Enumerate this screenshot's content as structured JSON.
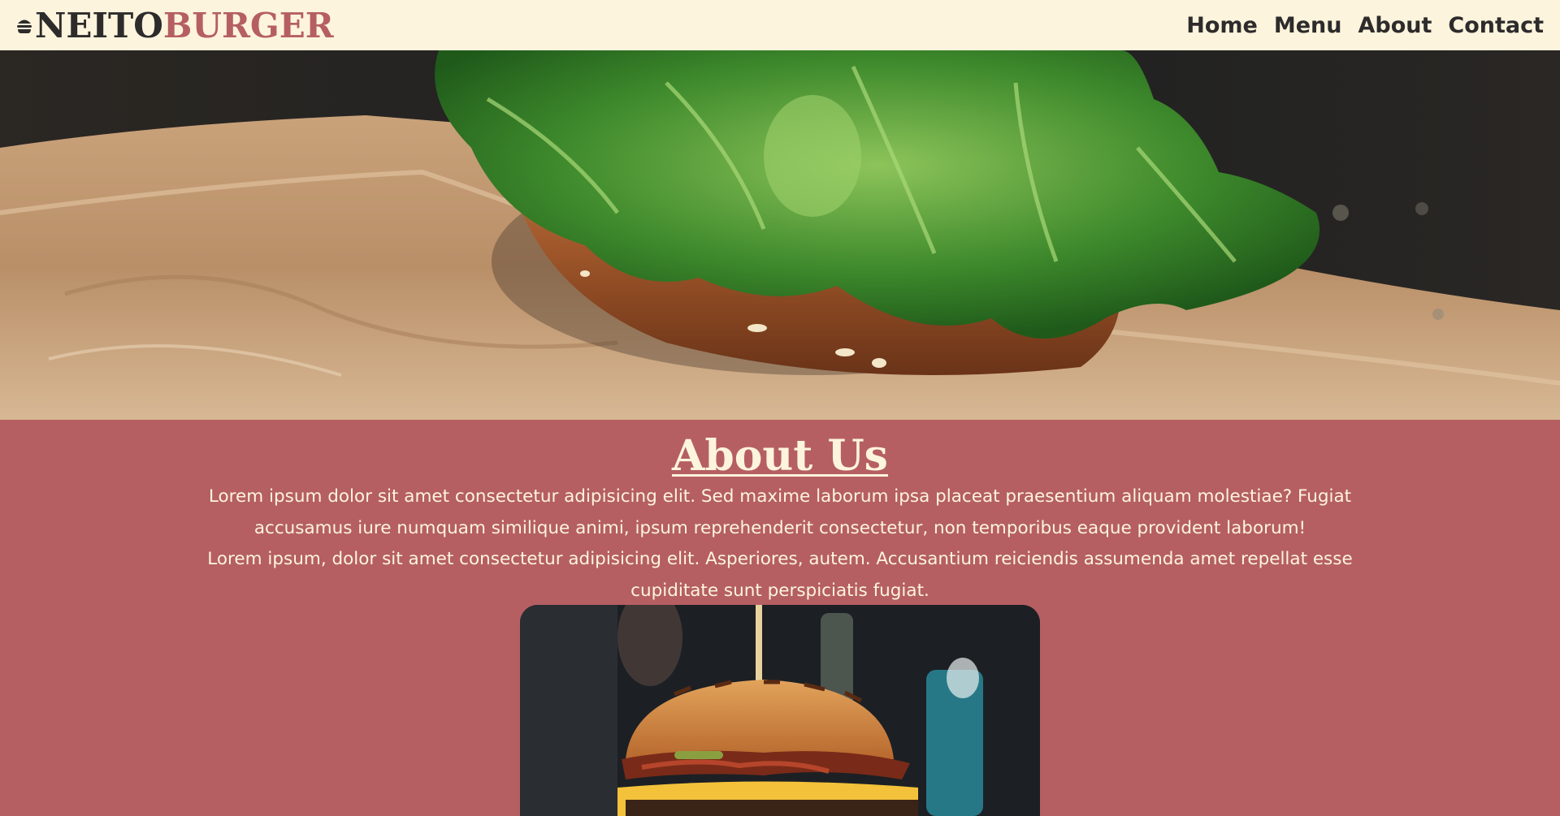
{
  "brand": {
    "icon": "burger-icon",
    "name_part1": "NEITO",
    "name_part2": "BURGER",
    "color_dark": "#2d2b2b",
    "color_accent": "#b55f63"
  },
  "nav": {
    "items": [
      {
        "label": "Home"
      },
      {
        "label": "Menu"
      },
      {
        "label": "About"
      },
      {
        "label": "Contact"
      }
    ]
  },
  "about": {
    "title": "About Us",
    "paragraphs": [
      "Lorem ipsum dolor sit amet consectetur adipisicing elit. Sed maxime laborum ipsa placeat praesentium aliquam molestiae? Fugiat accusamus iure numquam similique animi, ipsum reprehenderit consectetur, non temporibus eaque provident laborum!",
      "Lorem ipsum, dolor sit amet consectetur adipisicing elit. Asperiores, autem. Accusantium reiciendis assumenda amet repellat esse cupiditate sunt perspiciatis fugiat."
    ]
  },
  "colors": {
    "background": "#b55f63",
    "header_bg": "#fdf4dd",
    "text_light": "#fdf4dd"
  }
}
